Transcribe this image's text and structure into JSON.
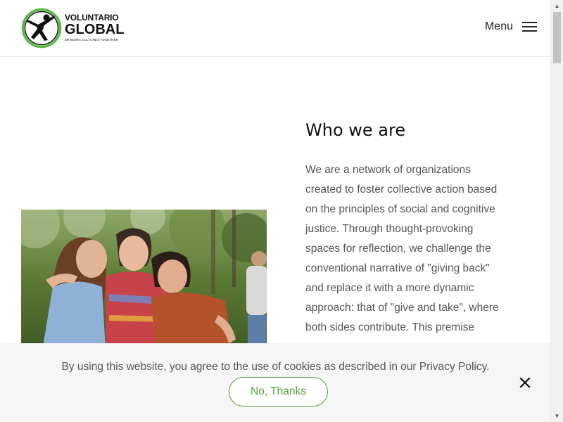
{
  "header": {
    "logo": {
      "line1": "VOLUNTARIO",
      "line2": "GLOBAL",
      "tagline": "BRINGING CULTURES TOGETHER"
    },
    "menu_label": "Menu"
  },
  "main": {
    "heading": "Who we are",
    "body_lines": [
      "We are a network of organizations",
      "created to foster collective action based",
      "on the principles of social and cognitive",
      "justice. Through thought-provoking",
      "spaces for reflection, we challenge the",
      "conventional narrative of \"giving back\"",
      "and replace it with a more dynamic",
      "approach: that of \"give and take\", where",
      "both sides contribute. This premise"
    ]
  },
  "cookie_banner": {
    "text": "By using this website, you agree to the use of cookies as described in our Privacy Policy.",
    "button_label": "No, Thanks"
  },
  "colors": {
    "brand_green": "#54a53c",
    "logo_green": "#58b947",
    "text_gray": "#555555"
  }
}
